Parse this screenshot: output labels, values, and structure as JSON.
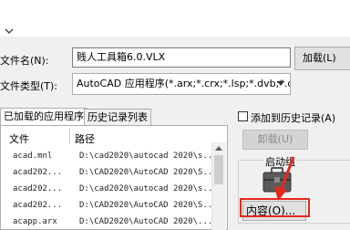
{
  "form": {
    "filename_label": "文件名(N):",
    "filename_value": "贱人工具箱6.0.VLX",
    "filetype_label": "文件类型(T):",
    "filetype_value": "AutoCAD 应用程序(*.arx;*.crx;*.lsp;*.dvb;*.dbx",
    "load_button": "加载(L)"
  },
  "tabs": [
    {
      "label": "已加载的应用程序",
      "active": true
    },
    {
      "label": "历史记录列表",
      "active": false
    }
  ],
  "table": {
    "columns": [
      "文件",
      "路径"
    ],
    "rows": [
      {
        "file": "acad.mnl",
        "path": "D:\\cad2020\\autocad 2020\\s..."
      },
      {
        "file": "acad202...",
        "path": "D:\\CAD2020\\AutoCAD 2020\\S..."
      },
      {
        "file": "acad202...",
        "path": "D:\\cad2020\\autocad 2020\\s..."
      },
      {
        "file": "acad202...",
        "path": "D:\\CAD2020\\AutoCAD 2020\\S..."
      },
      {
        "file": "acapp.arx",
        "path": "D:\\CAD2020\\AutoCAD 2020\\..."
      }
    ]
  },
  "right": {
    "history_checkbox_label": "添加到历史记录(A)",
    "history_checked": false,
    "unload_button": "卸载(U)",
    "startup_label": "启动组",
    "contents_button": "内容(O)..."
  },
  "colors": {
    "highlight": "#e8271c",
    "window_bg": "#f0f0f0",
    "border": "#adadad"
  }
}
